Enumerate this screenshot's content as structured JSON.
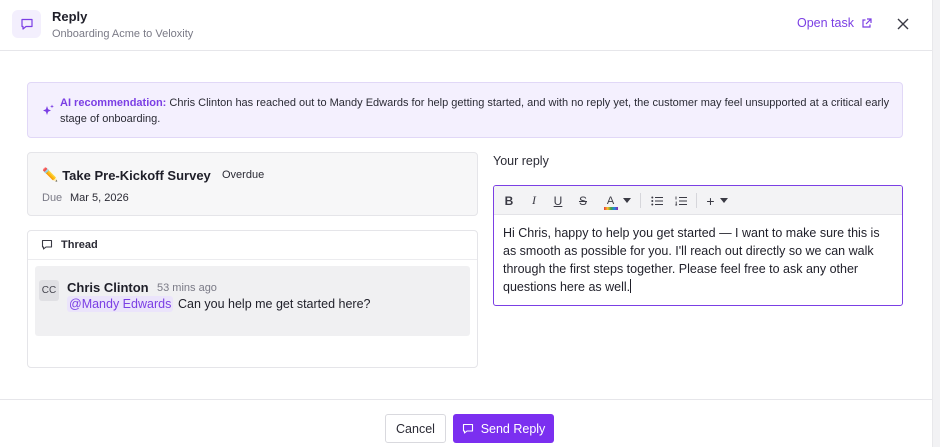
{
  "header": {
    "title": "Reply",
    "subtitle": "Onboarding Acme to Veloxity",
    "open_task_label": "Open task"
  },
  "ai_banner": {
    "label": "AI recommendation:",
    "text": "Chris Clinton has reached out to Mandy Edwards for help getting started, and with no reply yet, the customer may feel unsupported at a critical early stage of onboarding."
  },
  "task": {
    "emoji": "✏️",
    "title": "Take Pre-Kickoff Survey",
    "status": "Overdue",
    "due_label": "Due",
    "due_date": "Mar 5, 2026"
  },
  "thread": {
    "header_label": "Thread",
    "message": {
      "avatar_initials": "CC",
      "author": "Chris Clinton",
      "timestamp": "53 mins ago",
      "mention": "@Mandy Edwards",
      "text": "Can you help me get started here?"
    }
  },
  "reply": {
    "label": "Your reply",
    "body": "Hi Chris, happy to help you get started — I want to make sure this is as smooth as possible for you. I'll reach out directly so we can walk through the first steps together. Please feel free to ask any other questions here as well."
  },
  "toolbar": {
    "bold": "B",
    "italic": "I",
    "underline": "U",
    "strike": "S",
    "text_color": "A",
    "insert": "+"
  },
  "footer": {
    "cancel_label": "Cancel",
    "send_label": "Send Reply"
  },
  "colors": {
    "accent": "#7b3fe4",
    "primary_button": "#7b2ff0",
    "banner_bg": "#f4f0fe"
  }
}
